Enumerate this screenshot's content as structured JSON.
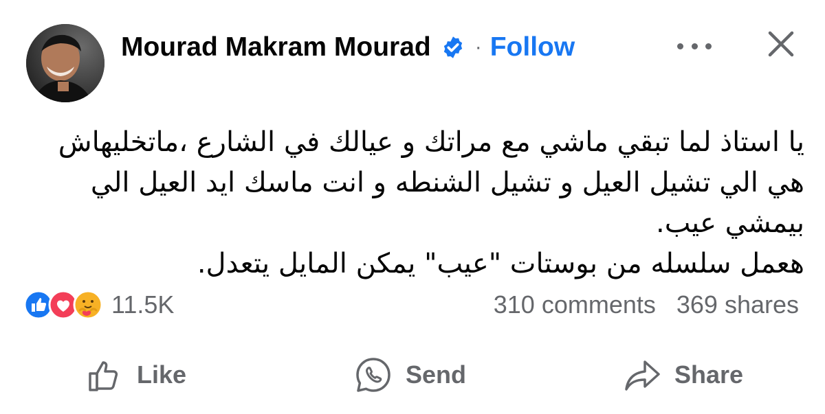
{
  "header": {
    "author_name": "Mourad Makram Mourad",
    "separator": "·",
    "follow_label": "Follow",
    "verified_icon": "verified-badge-icon",
    "more_icon": "more-dots-icon",
    "close_icon": "close-icon"
  },
  "post": {
    "paragraphs": [
      "يا استاذ لما تبقي ماشي مع مراتك و عيالك في الشارع ،ماتخليهاش هي الي تشيل العيل و تشيل الشنطه و انت ماسك ايد العيل الي بيمشي عيب.",
      "هعمل سلسله من بوستات \"عيب\" يمكن المايل يتعدل."
    ]
  },
  "reactions": {
    "icons": [
      "like-reaction-icon",
      "love-reaction-icon",
      "care-reaction-icon"
    ],
    "count": "11.5K"
  },
  "stats": {
    "comments": "310 comments",
    "shares": "369 shares"
  },
  "actions": {
    "like_label": "Like",
    "send_label": "Send",
    "share_label": "Share"
  },
  "colors": {
    "accent": "#1877f2",
    "secondary_text": "#65676b",
    "love": "#f33e58",
    "care": "#f7b125"
  }
}
